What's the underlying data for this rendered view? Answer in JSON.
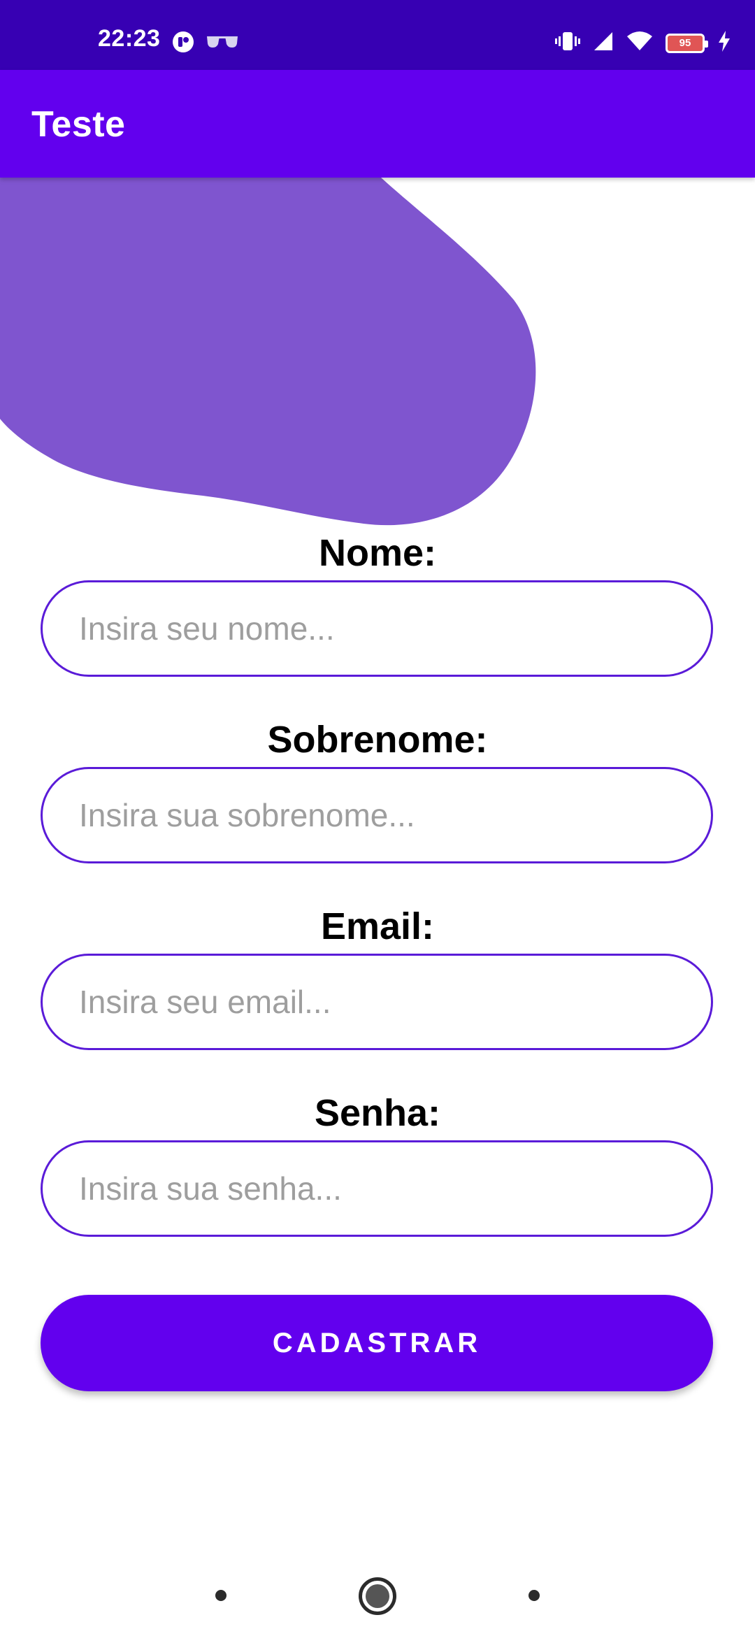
{
  "status_bar": {
    "time": "22:23",
    "battery_level": "95",
    "icons": [
      "app-notification-icon",
      "glasses-icon",
      "vibrate-icon",
      "signal-icon",
      "wifi-icon",
      "battery-icon",
      "charging-icon"
    ]
  },
  "app_bar": {
    "title": "Teste"
  },
  "form": {
    "fields": [
      {
        "label": "Nome:",
        "placeholder": "Insira seu nome..."
      },
      {
        "label": "Sobrenome:",
        "placeholder": "Insira sua sobrenome..."
      },
      {
        "label": "Email:",
        "placeholder": "Insira seu email..."
      },
      {
        "label": "Senha:",
        "placeholder": "Insira sua senha..."
      }
    ],
    "submit_label": "CADASTRAR"
  },
  "colors": {
    "status_bar": "#3700b3",
    "app_bar": "#6200ee",
    "blob": "#7f55cf",
    "input_border": "#5a1bd8",
    "button": "#6200ee"
  }
}
